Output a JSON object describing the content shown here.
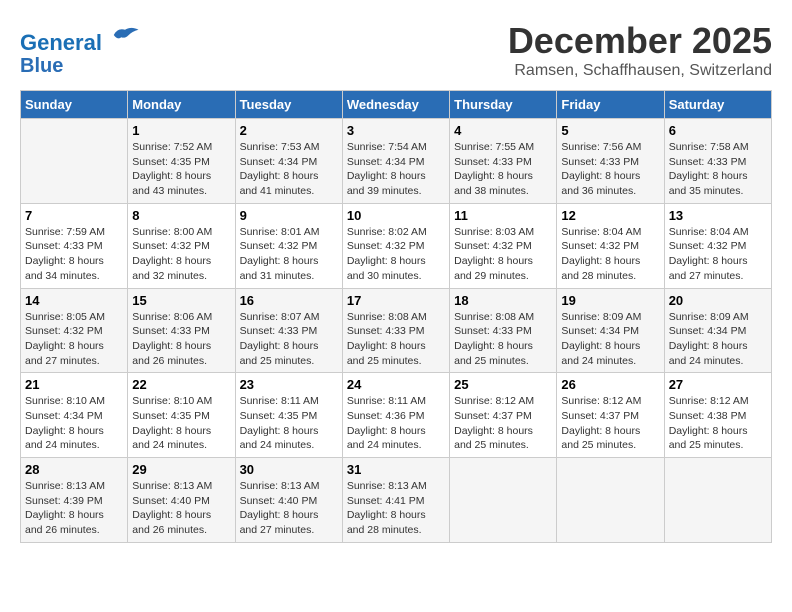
{
  "header": {
    "logo_line1": "General",
    "logo_line2": "Blue",
    "month": "December 2025",
    "location": "Ramsen, Schaffhausen, Switzerland"
  },
  "weekdays": [
    "Sunday",
    "Monday",
    "Tuesday",
    "Wednesday",
    "Thursday",
    "Friday",
    "Saturday"
  ],
  "weeks": [
    [
      {
        "day": "",
        "info": ""
      },
      {
        "day": "1",
        "info": "Sunrise: 7:52 AM\nSunset: 4:35 PM\nDaylight: 8 hours\nand 43 minutes."
      },
      {
        "day": "2",
        "info": "Sunrise: 7:53 AM\nSunset: 4:34 PM\nDaylight: 8 hours\nand 41 minutes."
      },
      {
        "day": "3",
        "info": "Sunrise: 7:54 AM\nSunset: 4:34 PM\nDaylight: 8 hours\nand 39 minutes."
      },
      {
        "day": "4",
        "info": "Sunrise: 7:55 AM\nSunset: 4:33 PM\nDaylight: 8 hours\nand 38 minutes."
      },
      {
        "day": "5",
        "info": "Sunrise: 7:56 AM\nSunset: 4:33 PM\nDaylight: 8 hours\nand 36 minutes."
      },
      {
        "day": "6",
        "info": "Sunrise: 7:58 AM\nSunset: 4:33 PM\nDaylight: 8 hours\nand 35 minutes."
      }
    ],
    [
      {
        "day": "7",
        "info": "Sunrise: 7:59 AM\nSunset: 4:33 PM\nDaylight: 8 hours\nand 34 minutes."
      },
      {
        "day": "8",
        "info": "Sunrise: 8:00 AM\nSunset: 4:32 PM\nDaylight: 8 hours\nand 32 minutes."
      },
      {
        "day": "9",
        "info": "Sunrise: 8:01 AM\nSunset: 4:32 PM\nDaylight: 8 hours\nand 31 minutes."
      },
      {
        "day": "10",
        "info": "Sunrise: 8:02 AM\nSunset: 4:32 PM\nDaylight: 8 hours\nand 30 minutes."
      },
      {
        "day": "11",
        "info": "Sunrise: 8:03 AM\nSunset: 4:32 PM\nDaylight: 8 hours\nand 29 minutes."
      },
      {
        "day": "12",
        "info": "Sunrise: 8:04 AM\nSunset: 4:32 PM\nDaylight: 8 hours\nand 28 minutes."
      },
      {
        "day": "13",
        "info": "Sunrise: 8:04 AM\nSunset: 4:32 PM\nDaylight: 8 hours\nand 27 minutes."
      }
    ],
    [
      {
        "day": "14",
        "info": "Sunrise: 8:05 AM\nSunset: 4:32 PM\nDaylight: 8 hours\nand 27 minutes."
      },
      {
        "day": "15",
        "info": "Sunrise: 8:06 AM\nSunset: 4:33 PM\nDaylight: 8 hours\nand 26 minutes."
      },
      {
        "day": "16",
        "info": "Sunrise: 8:07 AM\nSunset: 4:33 PM\nDaylight: 8 hours\nand 25 minutes."
      },
      {
        "day": "17",
        "info": "Sunrise: 8:08 AM\nSunset: 4:33 PM\nDaylight: 8 hours\nand 25 minutes."
      },
      {
        "day": "18",
        "info": "Sunrise: 8:08 AM\nSunset: 4:33 PM\nDaylight: 8 hours\nand 25 minutes."
      },
      {
        "day": "19",
        "info": "Sunrise: 8:09 AM\nSunset: 4:34 PM\nDaylight: 8 hours\nand 24 minutes."
      },
      {
        "day": "20",
        "info": "Sunrise: 8:09 AM\nSunset: 4:34 PM\nDaylight: 8 hours\nand 24 minutes."
      }
    ],
    [
      {
        "day": "21",
        "info": "Sunrise: 8:10 AM\nSunset: 4:34 PM\nDaylight: 8 hours\nand 24 minutes."
      },
      {
        "day": "22",
        "info": "Sunrise: 8:10 AM\nSunset: 4:35 PM\nDaylight: 8 hours\nand 24 minutes."
      },
      {
        "day": "23",
        "info": "Sunrise: 8:11 AM\nSunset: 4:35 PM\nDaylight: 8 hours\nand 24 minutes."
      },
      {
        "day": "24",
        "info": "Sunrise: 8:11 AM\nSunset: 4:36 PM\nDaylight: 8 hours\nand 24 minutes."
      },
      {
        "day": "25",
        "info": "Sunrise: 8:12 AM\nSunset: 4:37 PM\nDaylight: 8 hours\nand 25 minutes."
      },
      {
        "day": "26",
        "info": "Sunrise: 8:12 AM\nSunset: 4:37 PM\nDaylight: 8 hours\nand 25 minutes."
      },
      {
        "day": "27",
        "info": "Sunrise: 8:12 AM\nSunset: 4:38 PM\nDaylight: 8 hours\nand 25 minutes."
      }
    ],
    [
      {
        "day": "28",
        "info": "Sunrise: 8:13 AM\nSunset: 4:39 PM\nDaylight: 8 hours\nand 26 minutes."
      },
      {
        "day": "29",
        "info": "Sunrise: 8:13 AM\nSunset: 4:40 PM\nDaylight: 8 hours\nand 26 minutes."
      },
      {
        "day": "30",
        "info": "Sunrise: 8:13 AM\nSunset: 4:40 PM\nDaylight: 8 hours\nand 27 minutes."
      },
      {
        "day": "31",
        "info": "Sunrise: 8:13 AM\nSunset: 4:41 PM\nDaylight: 8 hours\nand 28 minutes."
      },
      {
        "day": "",
        "info": ""
      },
      {
        "day": "",
        "info": ""
      },
      {
        "day": "",
        "info": ""
      }
    ]
  ]
}
